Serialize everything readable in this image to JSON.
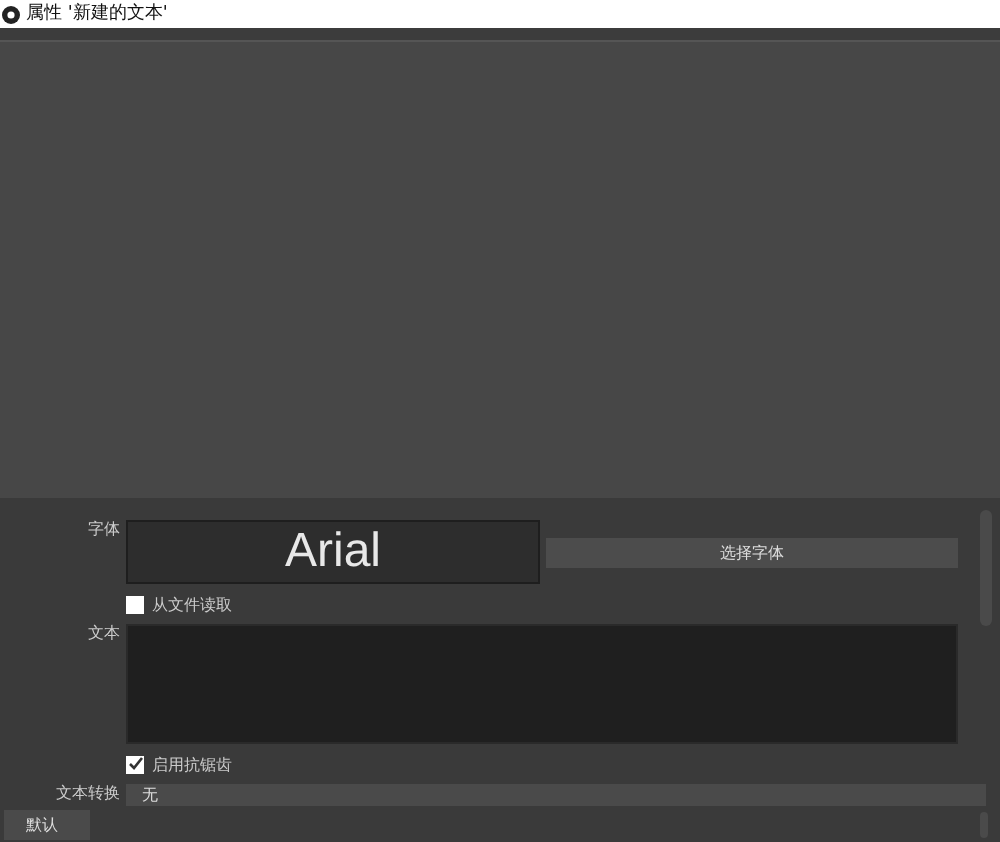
{
  "window": {
    "title": "属性 '新建的文本'"
  },
  "properties": [
    {
      "kind": "font",
      "label": "字体",
      "value": "Arial",
      "button": "选择字体"
    },
    {
      "kind": "checkbox",
      "label": "从文件读取",
      "checked": false
    },
    {
      "kind": "textarea",
      "label": "文本"
    },
    {
      "kind": "checkbox",
      "label": "启用抗锯齿",
      "checked": true
    },
    {
      "kind": "select",
      "label": "文本转换",
      "value": "无"
    }
  ],
  "buttons": [
    "默认"
  ]
}
